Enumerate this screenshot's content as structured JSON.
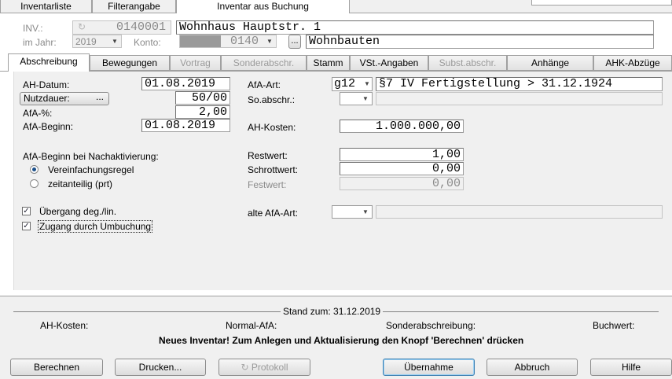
{
  "top_tabs": [
    "Inventarliste",
    "Filterangabe",
    "Inventar aus Buchung"
  ],
  "header": {
    "inv_label": "INV.:",
    "inv_value": "0140001",
    "inv_name": "Wohnhaus Hauptstr. 1",
    "year_label": "im Jahr:",
    "year_value": "2019",
    "konto_label": "Konto:",
    "konto_value": "0140",
    "konto_button": "...",
    "konto_name": "Wohnbauten"
  },
  "tabs": [
    "Abschreibung",
    "Bewegungen",
    "Vortrag",
    "Sonderabschr.",
    "Stamm",
    "VSt.-Angaben",
    "Subst.abschr.",
    "Anhänge",
    "AHK-Abzüge"
  ],
  "left": {
    "ah_datum_label": "AH-Datum:",
    "ah_datum": "01.08.2019",
    "nutzdauer_button": "Nutzdauer:",
    "nutzdauer_dots": "...",
    "nutzdauer": "50/00",
    "afa_pct_label": "AfA-%:",
    "afa_pct": "2,00",
    "afa_beginn_label": "AfA-Beginn:",
    "afa_beginn": "01.08.2019",
    "nachakt_label": "AfA-Beginn bei Nachaktivierung:",
    "radio1": "Vereinfachungsregel",
    "radio2": "zeitanteilig (prt)",
    "check1": "Übergang deg./lin.",
    "check2": "Zugang durch Umbuchung"
  },
  "right": {
    "afa_art_label": "AfA-Art:",
    "afa_art": "g12",
    "afa_art_desc": "§7 IV Fertigstellung > 31.12.1924",
    "so_abschr_label": "So.abschr.:",
    "ah_kosten_label": "AH-Kosten:",
    "ah_kosten": "1.000.000,00",
    "restwert_label": "Restwert:",
    "restwert": "1,00",
    "schrottwert_label": "Schrottwert:",
    "schrottwert": "0,00",
    "festwert_label": "Festwert:",
    "festwert": "0,00",
    "alte_afa_art_label": "alte AfA-Art:"
  },
  "summary": {
    "stand": "Stand zum: 31.12.2019",
    "ah_kosten": "AH-Kosten:",
    "normal_afa": "Normal-AfA:",
    "sonderabschreibung": "Sonderabschreibung:",
    "buchwert": "Buchwert:",
    "message": "Neues Inventar! Zum Anlegen und Aktualisierung den Knopf 'Berechnen' drücken"
  },
  "buttons": {
    "berechnen": "Berechnen",
    "drucken": "Drucken...",
    "protokoll": "Protokoll",
    "uebernahme": "Übernahme",
    "abbruch": "Abbruch",
    "hilfe": "Hilfe"
  },
  "icons": {
    "refresh": "refresh-icon",
    "dropdown": "chevron-down-icon",
    "checkmark": "checkmark-icon"
  }
}
